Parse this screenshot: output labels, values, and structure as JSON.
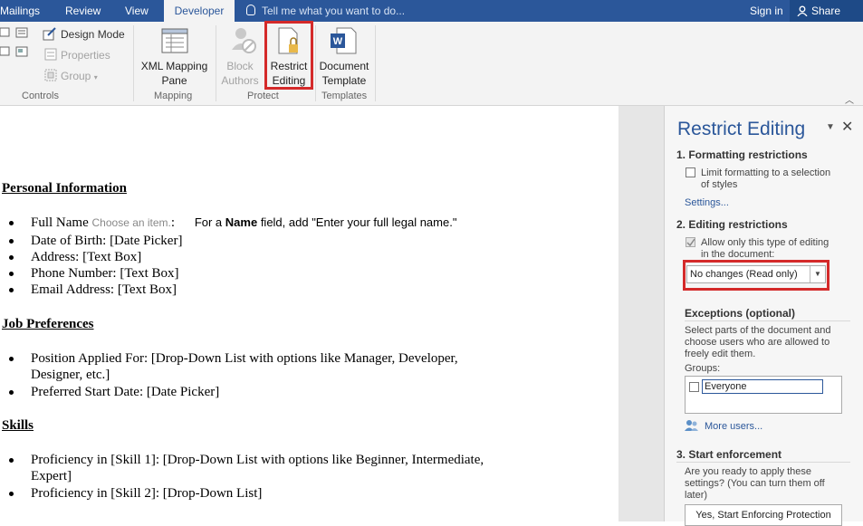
{
  "tabs": [
    "Mailings",
    "Review",
    "View",
    "Developer"
  ],
  "tell_me": "Tell me what you want to do...",
  "sign_in": "Sign in",
  "share": "Share",
  "ribbon": {
    "design_mode": "Design Mode",
    "properties": "Properties",
    "group": "Group",
    "xml_mapping_line1": "XML Mapping",
    "xml_mapping_line2": "Pane",
    "block_line1": "Block",
    "block_line2": "Authors",
    "restrict_line1": "Restrict",
    "restrict_line2": "Editing",
    "doc_template_line1": "Document",
    "doc_template_line2": "Template",
    "groups": [
      "Controls",
      "Mapping",
      "Protect",
      "Templates"
    ]
  },
  "document": {
    "h1": "Personal Information",
    "full_name_label": "Full Name",
    "full_name_placeholder": "Choose an item.",
    "full_name_colon": ":",
    "full_name_note_prefix": "For a ",
    "full_name_note_bold": "Name",
    "full_name_note_suffix": " field, add \"Enter your full legal name.\"",
    "personal_items": [
      "Date of Birth: [Date Picker]",
      "Address: [Text Box]",
      "Phone Number: [Text Box]",
      "Email Address: [Text Box]"
    ],
    "h2": "Job Preferences",
    "job_item1_line1": "Position Applied For: [Drop-Down List with options like Manager, Developer,",
    "job_item1_line2": "Designer, etc.]",
    "job_item2": "Preferred Start Date: [Date Picker]",
    "h3": "Skills",
    "skill_item1_line1": "Proficiency in [Skill 1]: [Drop-Down List with options like Beginner, Intermediate,",
    "skill_item1_line2": "Expert]",
    "skill_item2": "Proficiency in [Skill 2]: [Drop-Down List]"
  },
  "pane": {
    "title": "Restrict Editing",
    "sec1": "1. Formatting restrictions",
    "limit_line1": "Limit formatting to a selection",
    "limit_line2": "of styles",
    "settings": "Settings...",
    "sec2": "2. Editing restrictions",
    "allow_line1": "Allow only this type of editing",
    "allow_line2": "in the document:",
    "editing_type": "No changes (Read only)",
    "exceptions": "Exceptions (optional)",
    "exc_line1": "Select parts of the document and",
    "exc_line2": "choose users who are allowed to",
    "exc_line3": "freely edit them.",
    "groups_label": "Groups:",
    "everyone": "Everyone",
    "more_users": "More users...",
    "sec3": "3. Start enforcement",
    "ready_line1": "Are you ready to apply these",
    "ready_line2": "settings? (You can turn them off",
    "ready_line3": "later)",
    "enforce_button": "Yes, Start Enforcing Protection"
  }
}
